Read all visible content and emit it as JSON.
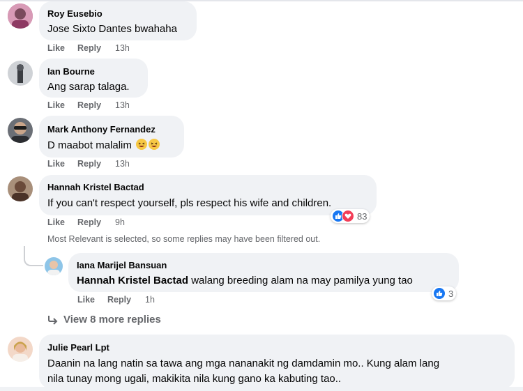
{
  "actions": {
    "like": "Like",
    "reply": "Reply"
  },
  "comments": [
    {
      "name": "Roy Eusebio",
      "text": "Jose Sixto Dantes bwahaha",
      "time": "13h"
    },
    {
      "name": "Ian Bourne",
      "text": "Ang sarap talaga.",
      "time": "13h"
    },
    {
      "name": "Mark Anthony Fernandez",
      "text": "D maabot malalim",
      "time": "13h",
      "emoji": [
        "grinning-squinting-face",
        "grinning-squinting-face"
      ]
    },
    {
      "name": "Hannah Kristel Bactad",
      "text": "If you can't respect yourself, pls respect his wife and children.",
      "time": "9h",
      "reactions": {
        "types": [
          "like",
          "love"
        ],
        "count": "83"
      }
    },
    {
      "name": "Julie Pearl Lpt",
      "text_line1": "Daanin na lang natin sa tawa ang mga nananakit ng damdamin mo.. Kung alam lang",
      "text_line2": "nila tunay mong ugali, makikita nila kung gano ka kabuting tao.."
    }
  ],
  "filter_notice": "Most Relevant is selected, so some replies may have been filtered out.",
  "reply": {
    "name": "Iana Marijel Bansuan",
    "tag": "Hannah Kristel Bactad",
    "text": " walang breeding alam na may pamilya yung tao",
    "time": "1h",
    "reactions": {
      "types": [
        "like"
      ],
      "count": "3"
    }
  },
  "view_more": "View 8 more replies"
}
